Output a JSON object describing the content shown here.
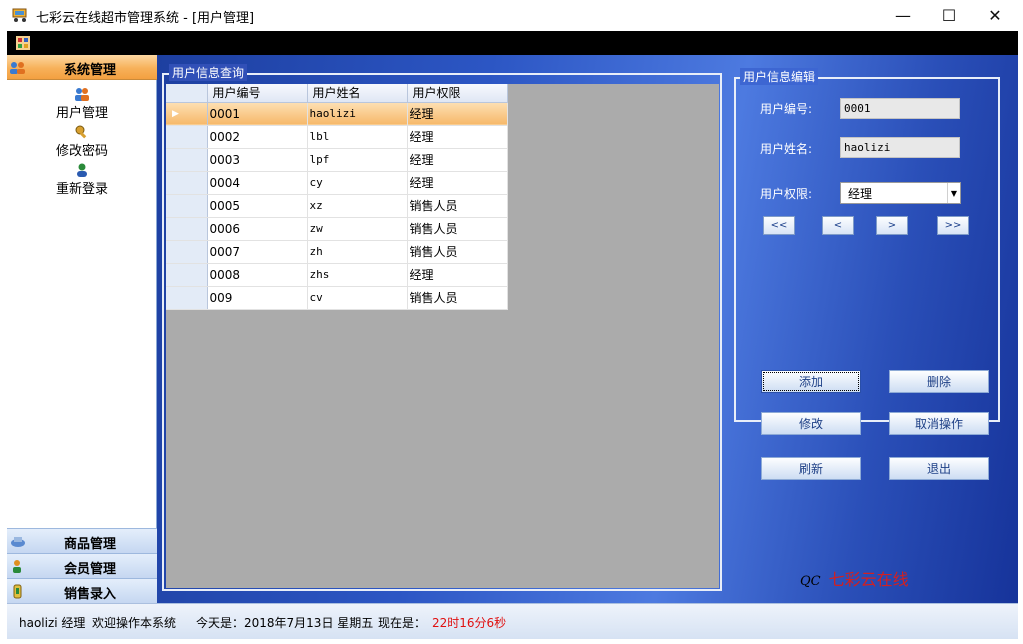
{
  "window": {
    "title": "七彩云在线超市管理系统 - [用户管理]",
    "minimize": "—",
    "maximize": "☐",
    "close": "✕"
  },
  "leftnav": {
    "system_section": "系统管理",
    "system_items": [
      "用户管理",
      "修改密码",
      "重新登录"
    ],
    "goods_section": "商品管理",
    "member_section": "会员管理",
    "sales_section": "销售录入"
  },
  "query": {
    "legend": "用户信息查询",
    "columns": [
      "用户编号",
      "用户姓名",
      "用户权限"
    ],
    "rows": [
      [
        "0001",
        "haolizi",
        "经理"
      ],
      [
        "0002",
        "lbl",
        "经理"
      ],
      [
        "0003",
        "lpf",
        "经理"
      ],
      [
        "0004",
        "cy",
        "经理"
      ],
      [
        "0005",
        "xz",
        "销售人员"
      ],
      [
        "0006",
        "zw",
        "销售人员"
      ],
      [
        "0007",
        "zh",
        "销售人员"
      ],
      [
        "0008",
        "zhs",
        "经理"
      ],
      [
        "009",
        "cv",
        "销售人员"
      ]
    ],
    "selected_row_marker": "▶"
  },
  "edit": {
    "legend": "用户信息编辑",
    "id_label": "用户编号:",
    "id_value": "0001",
    "name_label": "用户姓名:",
    "name_value": "haolizi",
    "role_label": "用户权限:",
    "role_value": "经理",
    "nav_first": "<<",
    "nav_prev": "<",
    "nav_next": ">",
    "nav_last": ">>",
    "btn_add": "添加",
    "btn_delete": "删除",
    "btn_modify": "修改",
    "btn_cancel": "取消操作",
    "btn_refresh": "刷新",
    "btn_exit": "退出"
  },
  "logo": {
    "mark": "QC",
    "text": "七彩云在线"
  },
  "status": {
    "user": "haolizi 经理",
    "welcome": "欢迎操作本系统",
    "today": "今天是：2018年7月13日 星期五",
    "now_label": "现在是：",
    "time": "22时16分6秒"
  },
  "colors": {
    "accent_orange": "#f6b86a",
    "panel_blue": "#2c56c4",
    "time_red": "#e01010"
  }
}
